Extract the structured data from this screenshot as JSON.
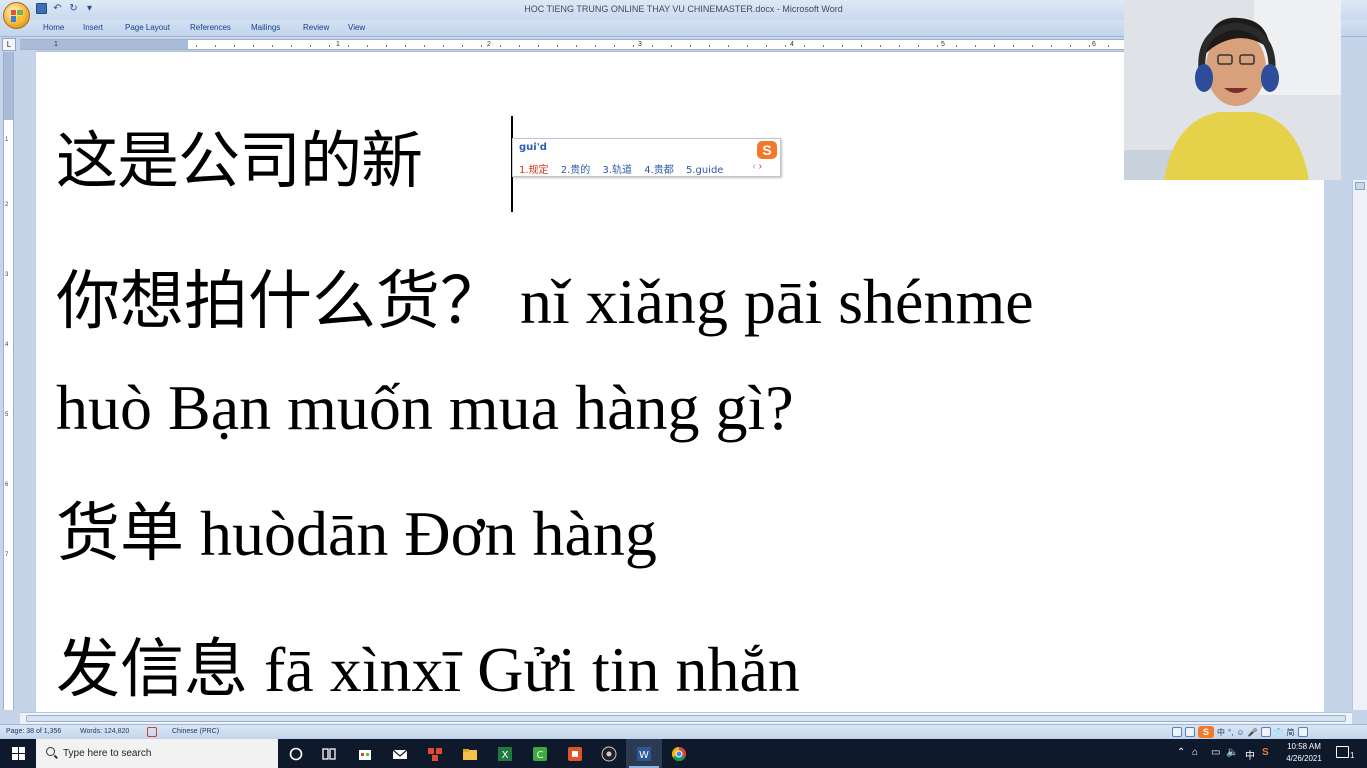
{
  "window": {
    "title": "HOC TIENG TRUNG ONLINE THAY VU CHINEMASTER.docx - Microsoft Word"
  },
  "ribbon": {
    "tabs": [
      "Home",
      "Insert",
      "Page Layout",
      "References",
      "Mailings",
      "Review",
      "View"
    ]
  },
  "ruler": {
    "numbers": [
      "1",
      "1",
      "2",
      "3",
      "4",
      "5",
      "6"
    ],
    "vertical_numbers": [
      "1",
      "2",
      "3",
      "4",
      "5",
      "6",
      "7"
    ]
  },
  "document": {
    "lines": [
      "这是公司的新",
      "你想拍什么货？ nǐ xiǎng pāi shénme",
      "huò Bạn muốn mua hàng gì?",
      "货单 huòdān Đơn hàng",
      "发信息 fā xìnxī Gửi tin nhắn"
    ]
  },
  "ime": {
    "composition": "gui'd",
    "candidates": [
      "1.规定",
      "2.贵的",
      "3.轨道",
      "4.贵都",
      "5.guide"
    ],
    "prev_arrow": "‹",
    "next_arrow": "›",
    "logo": "S"
  },
  "statusbar": {
    "page": "Page: 38 of 1,356",
    "words": "Words: 124,820",
    "language": "Chinese (PRC)",
    "ime_mode": "中",
    "ime_indicator": "简"
  },
  "taskbar": {
    "search_placeholder": "Type here to search",
    "time": "10:58 AM",
    "date": "4/26/2021",
    "input_lang": "中",
    "notification_count": "1"
  },
  "colors": {
    "ribbon_text": "#15428b",
    "ime_selected": "#d6331b",
    "ime_candidate": "#2e5aa8",
    "sogou_orange": "#f2792b",
    "taskbar": "#0e1a2b"
  }
}
